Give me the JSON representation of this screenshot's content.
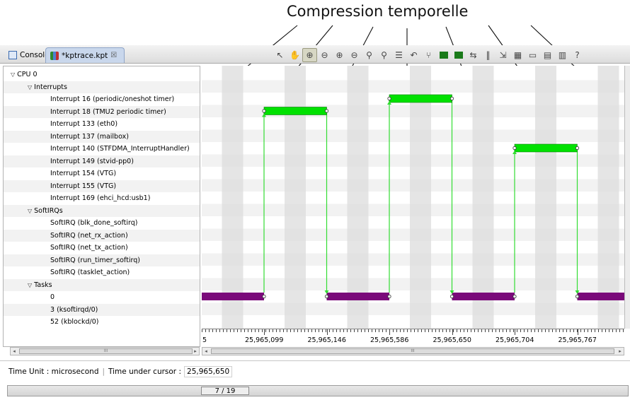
{
  "annotation": {
    "title": "Compression temporelle"
  },
  "tabs": [
    {
      "label": "Console",
      "icon": "console-icon"
    },
    {
      "label": "*kptrace.kpt",
      "icon": "trace-file-icon",
      "close": "☒"
    }
  ],
  "toolbar": {
    "icons": [
      "pointer-icon",
      "hand-icon",
      "zoom-in-time-icon",
      "zoom-out-time-icon",
      "zoom-in-icon",
      "zoom-out-icon",
      "filter-icon",
      "filter-advanced-icon",
      "list-icon",
      "undo-icon",
      "branch-icon",
      "green-chart-icon",
      "green-chart-2-icon",
      "compare-icon",
      "marker-icon",
      "export-icon",
      "layout-icon",
      "window-icon",
      "properties-icon",
      "properties-2-icon",
      "help-icon"
    ],
    "active_index": 2,
    "colors": {
      "green_chart": "#1a7a1a"
    }
  },
  "tree": {
    "rows": [
      {
        "label": "CPU 0",
        "level": 0,
        "expanded": true
      },
      {
        "label": "Interrupts",
        "level": 1,
        "expanded": true
      },
      {
        "label": "Interrupt 16 (periodic/oneshot timer)",
        "level": 2
      },
      {
        "label": "Interrupt 18 (TMU2 periodic timer)",
        "level": 2
      },
      {
        "label": "Interrupt 133 (eth0)",
        "level": 2
      },
      {
        "label": "Interrupt 137 (mailbox)",
        "level": 2
      },
      {
        "label": "Interrupt 140 (STFDMA_InterruptHandler)",
        "level": 2
      },
      {
        "label": "Interrupt 149 (stvid-pp0)",
        "level": 2
      },
      {
        "label": "Interrupt 154 (VTG)",
        "level": 2
      },
      {
        "label": "Interrupt 155 (VTG)",
        "level": 2
      },
      {
        "label": "Interrupt 169 (ehci_hcd:usb1)",
        "level": 2
      },
      {
        "label": "SoftIRQs",
        "level": 1,
        "expanded": true
      },
      {
        "label": "SoftIRQ (blk_done_softirq)",
        "level": 2
      },
      {
        "label": "SoftIRQ (net_rx_action)",
        "level": 2
      },
      {
        "label": "SoftIRQ (net_tx_action)",
        "level": 2
      },
      {
        "label": "SoftIRQ (run_timer_softirq)",
        "level": 2
      },
      {
        "label": "SoftIRQ (tasklet_action)",
        "level": 2
      },
      {
        "label": "Tasks",
        "level": 1,
        "expanded": true
      },
      {
        "label": "0",
        "level": 2
      },
      {
        "label": "3 (ksoftirqd/0)",
        "level": 2
      },
      {
        "label": "52 (kblockd/0)",
        "level": 2
      }
    ],
    "expand_glyph": "▽"
  },
  "timeline": {
    "colors": {
      "interrupt": "#00e100",
      "task": "#7a0a7a",
      "link": "#33dd33",
      "compressed_band": "#dcdcdc",
      "row_alt": "#f2f2f2"
    },
    "compressed_gaps": 7,
    "interrupt_bars": [
      {
        "row": 3,
        "start_tick": 0,
        "end_tick": 1
      },
      {
        "row": 2,
        "start_tick": 2,
        "end_tick": 3
      },
      {
        "row": 6,
        "start_tick": 4,
        "end_tick": 5
      }
    ],
    "task_row": 18,
    "task_segments": [
      {
        "from_tick": -1,
        "to_tick": 0
      },
      {
        "from_tick": 1,
        "to_tick": 2
      },
      {
        "from_tick": 3,
        "to_tick": 4
      },
      {
        "from_tick": 5,
        "to_tick": 6
      }
    ],
    "axis": {
      "first_partial_label": "5",
      "ticks": [
        "25,965,099",
        "25,965,146",
        "25,965,586",
        "25,965,650",
        "25,965,704",
        "25,965,767"
      ]
    }
  },
  "scrollbars": {
    "tree_thumb": "III",
    "time_thumb": "III"
  },
  "status": {
    "time_unit": "Time Unit : microsecond",
    "cursor_label": "Time under cursor :",
    "cursor_value": "25,965,650"
  },
  "pager": {
    "indicator": "7 / 19"
  }
}
